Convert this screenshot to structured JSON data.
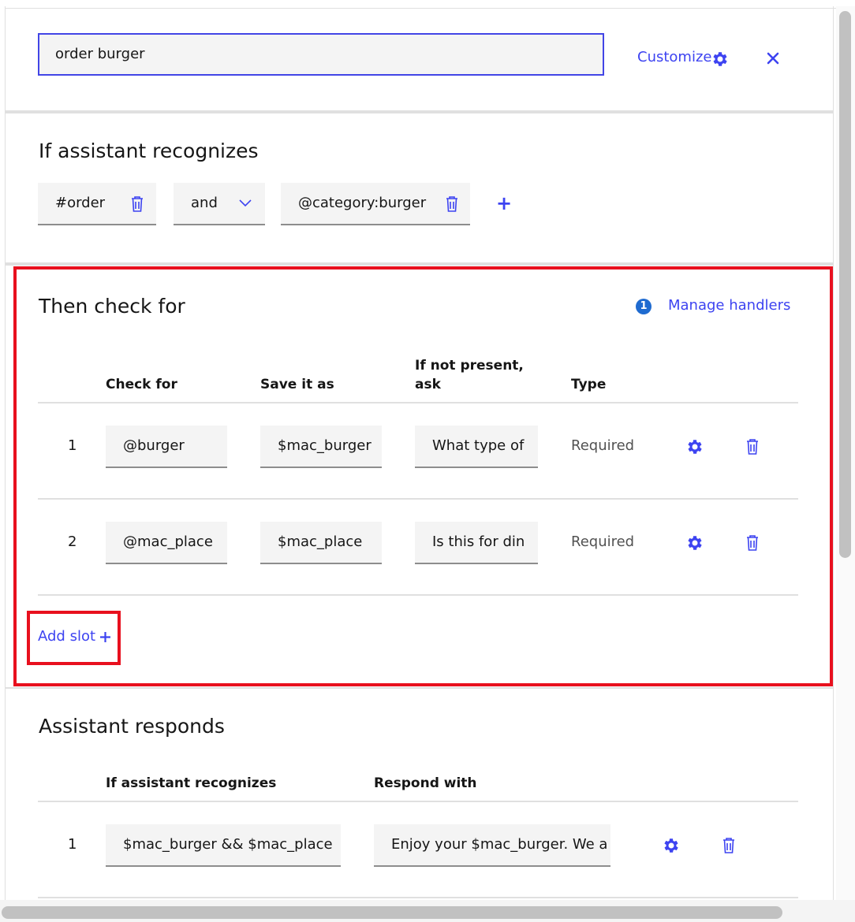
{
  "header": {
    "node_name_value": "order burger",
    "customize_label": "Customize",
    "close_label": "×"
  },
  "recognizes": {
    "title": "If assistant recognizes",
    "condition1": "#order",
    "operator": "and",
    "condition2": "@category:burger",
    "add_label": "+"
  },
  "slots": {
    "title": "Then check for",
    "handlers_count": "1",
    "manage_handlers_label": "Manage handlers",
    "columns": [
      "Check for",
      "Save it as",
      "If not present,\nask",
      "Type"
    ],
    "rows": [
      {
        "num": "1",
        "check_for": "@burger",
        "save_as": "$mac_burger",
        "ask": "What type of",
        "type": "Required"
      },
      {
        "num": "2",
        "check_for": "@mac_place",
        "save_as": "$mac_place",
        "ask": "Is this for din",
        "type": "Required"
      }
    ],
    "add_slot_label": "Add slot"
  },
  "responds": {
    "title": "Assistant responds",
    "columns": [
      "If assistant recognizes",
      "Respond with"
    ],
    "rows": [
      {
        "num": "1",
        "condition": "$mac_burger &&  $mac_place",
        "response": "Enjoy your $mac_burger. We a"
      }
    ]
  },
  "colors": {
    "accent": "#3d43f1",
    "highlight": "#e8101e",
    "field_bg": "#f4f4f4"
  }
}
